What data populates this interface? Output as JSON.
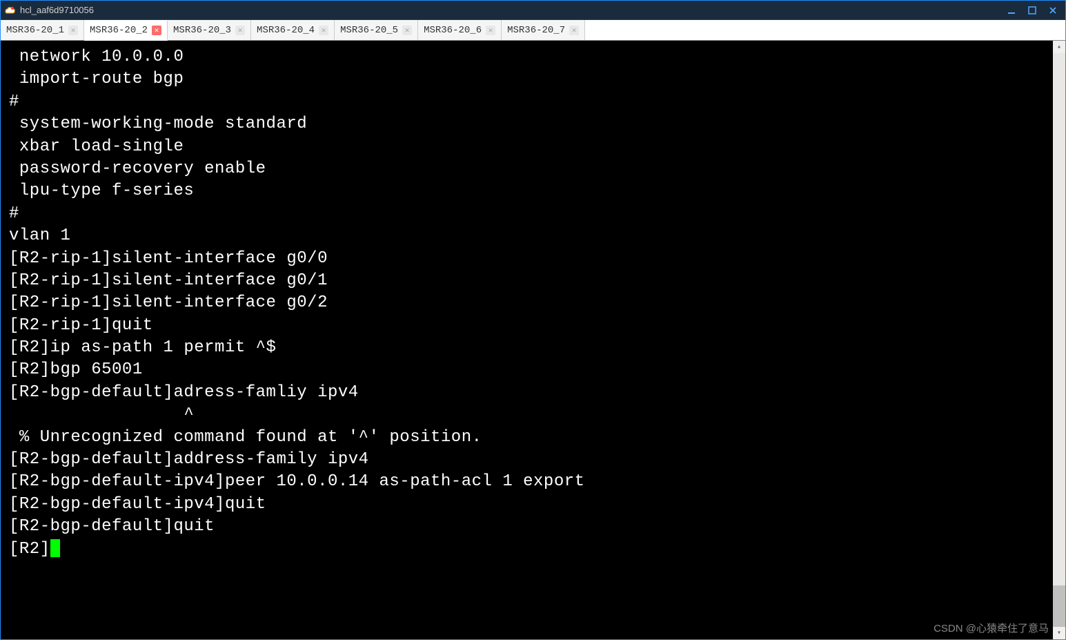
{
  "window": {
    "title": "hcl_aaf6d9710056"
  },
  "tabs": [
    {
      "label": "MSR36-20_1",
      "active": false
    },
    {
      "label": "MSR36-20_2",
      "active": true
    },
    {
      "label": "MSR36-20_3",
      "active": false
    },
    {
      "label": "MSR36-20_4",
      "active": false
    },
    {
      "label": "MSR36-20_5",
      "active": false
    },
    {
      "label": "MSR36-20_6",
      "active": false
    },
    {
      "label": "MSR36-20_7",
      "active": false
    }
  ],
  "terminal": {
    "lines": [
      " network 10.0.0.0",
      " import-route bgp",
      "#",
      " system-working-mode standard",
      " xbar load-single",
      " password-recovery enable",
      " lpu-type f-series",
      "#",
      "vlan 1",
      "[R2-rip-1]silent-interface g0/0",
      "[R2-rip-1]silent-interface g0/1",
      "[R2-rip-1]silent-interface g0/2",
      "[R2-rip-1]quit",
      "[R2]ip as-path 1 permit ^$",
      "[R2]bgp 65001",
      "[R2-bgp-default]adress-famliy ipv4",
      "                 ^",
      " % Unrecognized command found at '^' position.",
      "[R2-bgp-default]address-family ipv4",
      "[R2-bgp-default-ipv4]peer 10.0.0.14 as-path-acl 1 export",
      "[R2-bgp-default-ipv4]quit",
      "[R2-bgp-default]quit"
    ],
    "prompt": "[R2]"
  },
  "watermark": "CSDN @心猿牵住了意马"
}
